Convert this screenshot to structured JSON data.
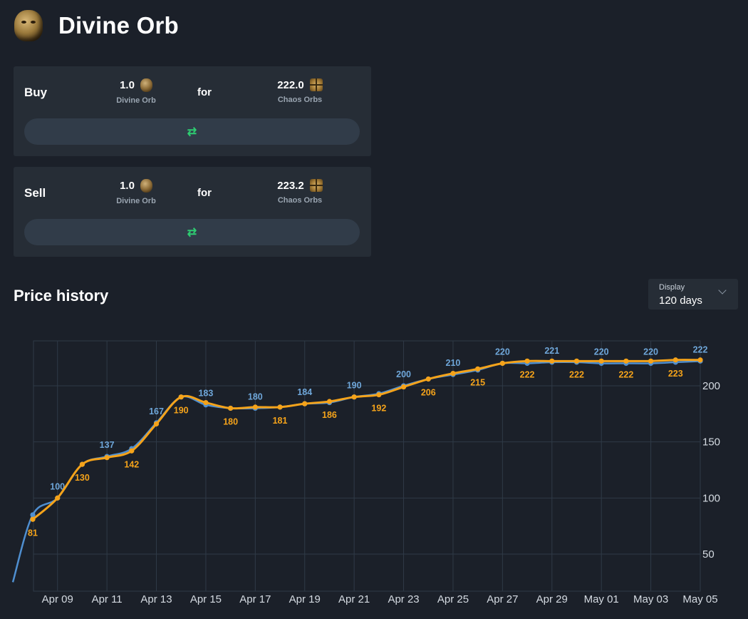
{
  "header": {
    "title": "Divine Orb",
    "icon": "divine-orb-icon"
  },
  "buy": {
    "label": "Buy",
    "pay_amount": "1.0",
    "pay_currency": "Divine Orb",
    "for_label": "for",
    "get_amount": "222.0",
    "get_currency": "Chaos Orbs",
    "swap_icon": "⇄"
  },
  "sell": {
    "label": "Sell",
    "pay_amount": "1.0",
    "pay_currency": "Divine Orb",
    "for_label": "for",
    "get_amount": "223.2",
    "get_currency": "Chaos Orbs",
    "swap_icon": "⇄"
  },
  "price_history": {
    "title": "Price history",
    "display_label": "Display",
    "display_value": "120 days"
  },
  "colors": {
    "buy_series": "#4f8fd0",
    "sell_series": "#f5a31a",
    "grid": "#2f3a47",
    "swap": "#2ecc71"
  },
  "chart_data": {
    "type": "line",
    "x": [
      "Apr 08",
      "Apr 09",
      "Apr 10",
      "Apr 11",
      "Apr 12",
      "Apr 13",
      "Apr 14",
      "Apr 15",
      "Apr 16",
      "Apr 17",
      "Apr 18",
      "Apr 19",
      "Apr 20",
      "Apr 21",
      "Apr 22",
      "Apr 23",
      "Apr 24",
      "Apr 25",
      "Apr 26",
      "Apr 27",
      "Apr 28",
      "Apr 29",
      "Apr 30",
      "May 01",
      "May 02",
      "May 03",
      "May 04",
      "May 05"
    ],
    "x_tick_labels": [
      "Apr 09",
      "Apr 11",
      "Apr 13",
      "Apr 15",
      "Apr 17",
      "Apr 19",
      "Apr 21",
      "Apr 23",
      "Apr 25",
      "Apr 27",
      "Apr 29",
      "May 01",
      "May 03",
      "May 05"
    ],
    "y_ticks": [
      50,
      100,
      150,
      200
    ],
    "ylim": [
      17,
      240
    ],
    "grid": true,
    "series": [
      {
        "values": [
          85,
          100,
          130,
          137,
          144,
          167,
          190,
          183,
          180,
          180,
          181,
          184,
          185,
          190,
          193,
          200,
          206,
          210,
          214,
          220,
          220,
          221,
          221,
          220,
          220,
          220,
          221,
          222
        ],
        "point_labels": [
          null,
          "100",
          null,
          "137",
          null,
          "167",
          null,
          "183",
          null,
          "180",
          null,
          "184",
          null,
          "190",
          null,
          "200",
          null,
          "210",
          null,
          "220",
          null,
          "221",
          null,
          "220",
          null,
          "220",
          null,
          "222"
        ],
        "lead_in_value": 25
      },
      {
        "values": [
          81,
          100,
          130,
          136,
          142,
          166,
          190,
          185,
          180,
          181,
          181,
          184,
          186,
          190,
          192,
          199,
          206,
          211,
          215,
          220,
          222,
          222,
          222,
          222,
          222,
          222,
          223,
          223
        ],
        "point_labels": [
          "81",
          null,
          "130",
          null,
          "142",
          null,
          "190",
          null,
          "180",
          null,
          "181",
          null,
          "186",
          null,
          "192",
          null,
          "206",
          null,
          "215",
          null,
          "222",
          null,
          "222",
          null,
          "222",
          null,
          "223",
          null
        ]
      }
    ]
  }
}
